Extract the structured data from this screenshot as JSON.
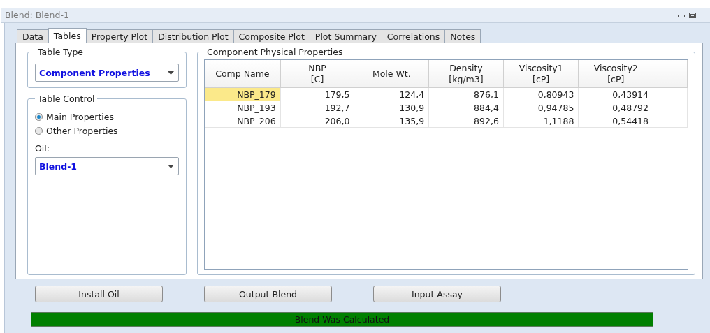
{
  "window": {
    "title": "Blend: Blend-1"
  },
  "tabs": [
    {
      "label": "Data",
      "selected": false
    },
    {
      "label": "Tables",
      "selected": true
    },
    {
      "label": "Property Plot",
      "selected": false
    },
    {
      "label": "Distribution Plot",
      "selected": false
    },
    {
      "label": "Composite Plot",
      "selected": false
    },
    {
      "label": "Plot Summary",
      "selected": false
    },
    {
      "label": "Correlations",
      "selected": false
    },
    {
      "label": "Notes",
      "selected": false
    }
  ],
  "table_type": {
    "legend": "Table Type",
    "value": "Component Properties"
  },
  "table_control": {
    "legend": "Table Control",
    "options": [
      {
        "label": "Main Properties",
        "selected": true
      },
      {
        "label": "Other Properties",
        "selected": false
      }
    ],
    "oil_label": "Oil:",
    "oil_value": "Blend-1"
  },
  "table": {
    "legend": "Component Physical Properties",
    "columns": [
      {
        "label": "Comp Name"
      },
      {
        "label": "NBP",
        "unit": "[C]"
      },
      {
        "label": "Mole Wt."
      },
      {
        "label": "Density",
        "unit": "[kg/m3]"
      },
      {
        "label": "Viscosity1",
        "unit": "[cP]"
      },
      {
        "label": "Viscosity2",
        "unit": "[cP]"
      }
    ],
    "rows": [
      {
        "selected": true,
        "cells": [
          "NBP_179",
          "179,5",
          "124,4",
          "876,1",
          "0,80943",
          "0,43914"
        ]
      },
      {
        "selected": false,
        "cells": [
          "NBP_193",
          "192,7",
          "130,9",
          "884,4",
          "0,94785",
          "0,48792"
        ]
      },
      {
        "selected": false,
        "cells": [
          "NBP_206",
          "206,0",
          "135,9",
          "892,6",
          "1,1188",
          "0,54418"
        ]
      }
    ]
  },
  "buttons": [
    "Install Oil",
    "Output Blend",
    "Input Assay"
  ],
  "status_bar": {
    "text": "Blend Was Calculated"
  }
}
